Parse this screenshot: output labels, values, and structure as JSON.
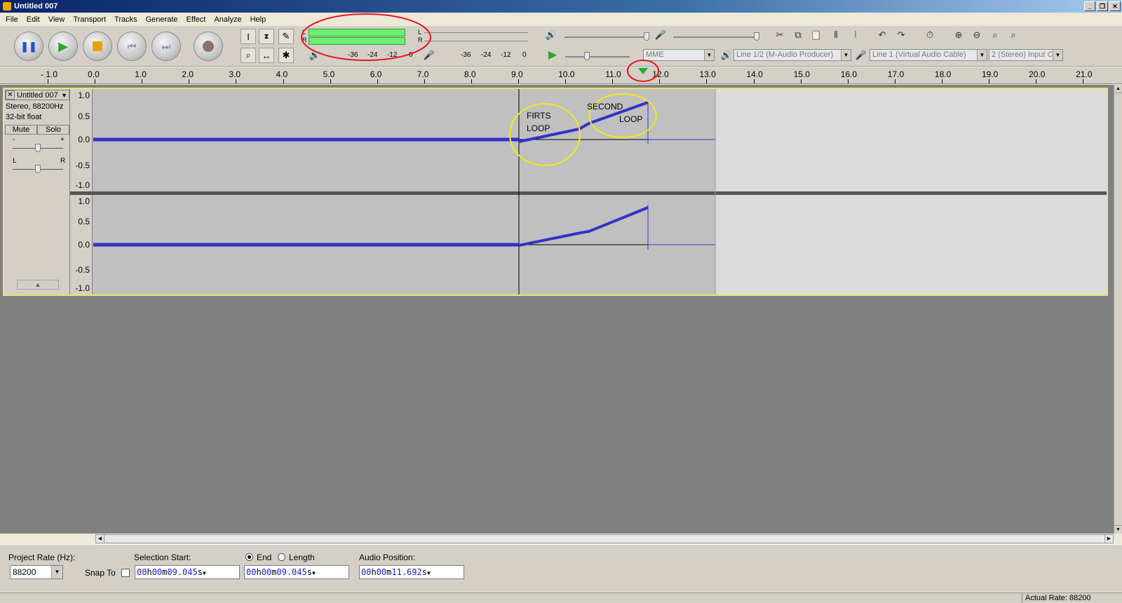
{
  "window": {
    "title": "Untitled 007"
  },
  "menu": [
    "File",
    "Edit",
    "View",
    "Transport",
    "Tracks",
    "Generate",
    "Effect",
    "Analyze",
    "Help"
  ],
  "meters": {
    "l": "L",
    "r": "R",
    "play_scale": [
      "-36",
      "-24",
      "-12",
      "0"
    ],
    "rec_scale": [
      "-36",
      "-24",
      "-12",
      "0"
    ]
  },
  "device": {
    "host": "MME",
    "output": "Line 1/2 (M-Audio Producer)",
    "input": "Line 1 (Virtual Audio Cable)",
    "channels": "2 (Stereo) Input C"
  },
  "ruler": [
    "- 1.0",
    "0.0",
    "1.0",
    "2.0",
    "3.0",
    "4.0",
    "5.0",
    "6.0",
    "7.0",
    "8.0",
    "9.0",
    "10.0",
    "11.0",
    "12.0",
    "13.0",
    "14.0",
    "15.0",
    "16.0",
    "17.0",
    "18.0",
    "19.0",
    "20.0",
    "21.0"
  ],
  "track": {
    "name": "Untitled 007",
    "info1": "Stereo, 88200Hz",
    "info2": "32-bit float",
    "mute": "Mute",
    "solo": "Solo",
    "gain_l": "-",
    "gain_r": "+",
    "pan_l": "L",
    "pan_r": "R",
    "scale": [
      "1.0",
      "0.5",
      "0.0",
      "-0.5",
      "-1.0"
    ]
  },
  "annotations": {
    "first1": "FIRTS",
    "first2": "LOOP",
    "second1": "SECOND",
    "second2": "LOOP"
  },
  "bottom": {
    "project_rate_label": "Project Rate (Hz):",
    "project_rate": "88200",
    "snap_to": "Snap To",
    "selection_start_label": "Selection Start:",
    "end_label": "End",
    "length_label": "Length",
    "audio_position_label": "Audio Position:",
    "sel_start": {
      "h": "00",
      "m": "00",
      "s": "09.045"
    },
    "sel_end": {
      "h": "00",
      "m": "00",
      "s": "09.045"
    },
    "audio_pos": {
      "h": "00",
      "m": "00",
      "s": "11.692"
    },
    "unit_h": "h",
    "unit_m": "m",
    "unit_s": "s"
  },
  "status": {
    "actual_rate": "Actual Rate: 88200"
  },
  "colors": {
    "wave": "#3232c8",
    "highlight_red": "#e8141e",
    "highlight_yellow": "#f0ea1e"
  }
}
